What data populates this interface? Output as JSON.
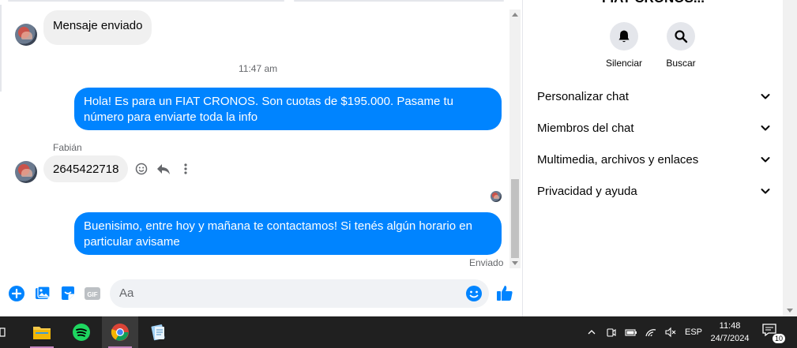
{
  "conversation": {
    "title": "FIAT CRONOS..."
  },
  "messages": {
    "first_incoming": "Mensaje enviado",
    "timestamp": "11:47 am",
    "outgoing_1": "Hola! Es para un FIAT CRONOS. Son cuotas de $195.000. Pasame tu número para enviarte toda la info",
    "sender_name": "Fabián",
    "incoming_phone": "2645422718",
    "outgoing_2": "Buenisimo, entre hoy y mañana te contactamos! Si tenés algún horario en particular avisame",
    "status": "Enviado"
  },
  "composer": {
    "placeholder": "Aa"
  },
  "panel": {
    "actions": [
      {
        "label": "Silenciar",
        "icon": "bell-icon"
      },
      {
        "label": "Buscar",
        "icon": "search-icon"
      }
    ],
    "sections": [
      {
        "label": "Personalizar chat"
      },
      {
        "label": "Miembros del chat"
      },
      {
        "label": "Multimedia, archivos y enlaces"
      },
      {
        "label": "Privacidad y ayuda"
      }
    ]
  },
  "taskbar": {
    "language": "ESP",
    "time": "11:48",
    "date": "24/7/2024",
    "notification_count": "10"
  },
  "colors": {
    "accent": "#0084ff",
    "incoming_bubble": "#f0f0f0",
    "taskbar": "#202020"
  }
}
